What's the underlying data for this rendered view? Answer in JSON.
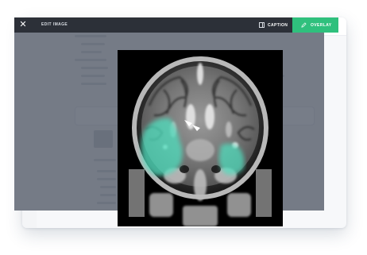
{
  "editor": {
    "title": "EDIT IMAGE",
    "caption_label": "CAPTION",
    "overlay_label": "OVERLAY"
  },
  "icons": {
    "logo": "triangle-logo-icon",
    "close": "close-icon",
    "caption": "caption-panel-icon",
    "overlay": "pencil-icon"
  },
  "colors": {
    "accent": "#2fc07d",
    "toolbar": "#2c3038",
    "highlight": "#4fe0bf"
  },
  "image": {
    "highlights": [
      {
        "label": "left-temporal-region"
      },
      {
        "label": "right-temporal-region"
      }
    ],
    "arrowheads": 2
  }
}
